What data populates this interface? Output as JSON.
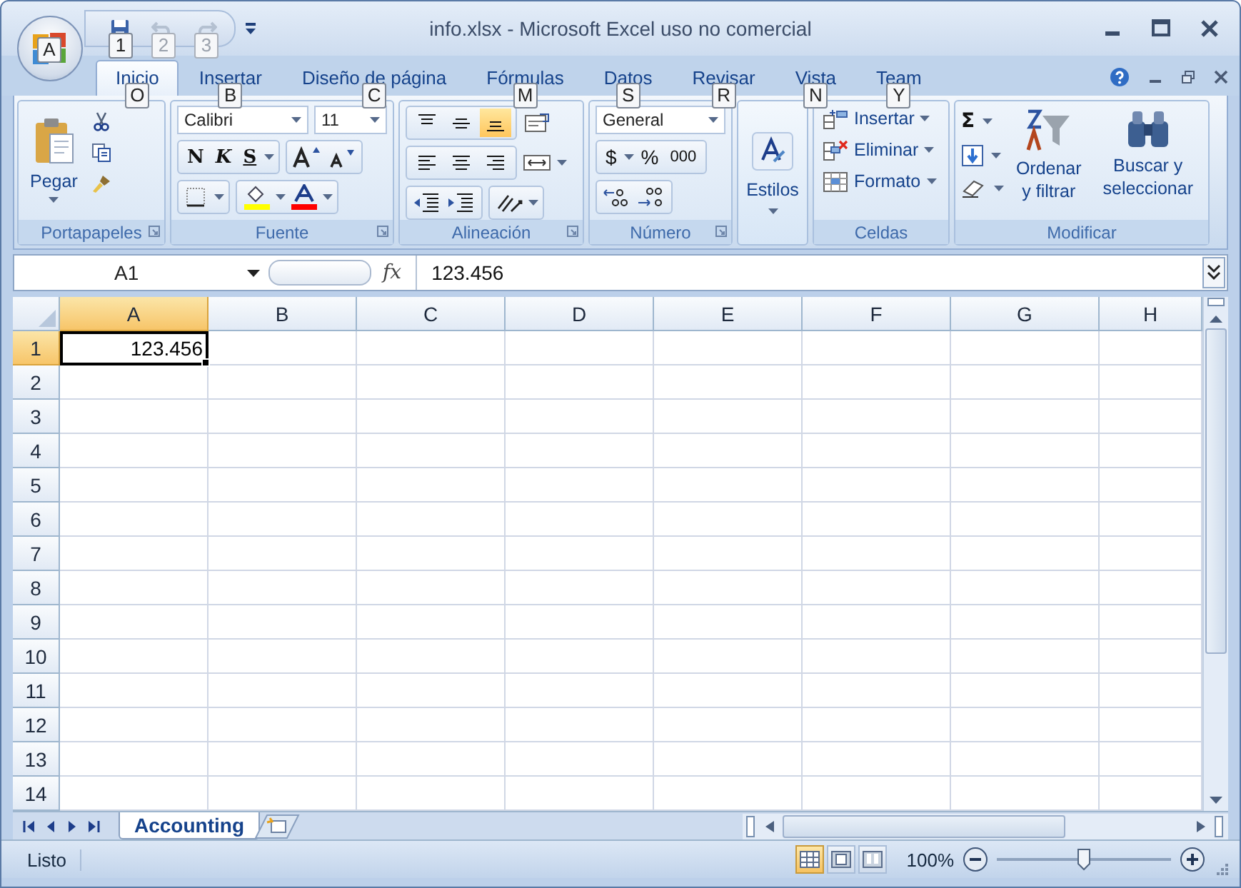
{
  "window": {
    "title": "info.xlsx - Microsoft Excel uso no comercial",
    "office_keytip": "A"
  },
  "quick_access": [
    {
      "kind": "save",
      "keytip": "1",
      "disabled": false
    },
    {
      "kind": "undo",
      "keytip": "2",
      "disabled": true
    },
    {
      "kind": "redo",
      "keytip": "3",
      "disabled": true
    }
  ],
  "tabs": [
    {
      "label": "Inicio",
      "keytip": "O",
      "selected": true
    },
    {
      "label": "Insertar",
      "keytip": "B",
      "selected": false
    },
    {
      "label": "Diseño de página",
      "keytip": "C",
      "selected": false
    },
    {
      "label": "Fórmulas",
      "keytip": "M",
      "selected": false
    },
    {
      "label": "Datos",
      "keytip": "S",
      "selected": false
    },
    {
      "label": "Revisar",
      "keytip": "R",
      "selected": false
    },
    {
      "label": "Vista",
      "keytip": "N",
      "selected": false
    },
    {
      "label": "Team",
      "keytip": "Y",
      "selected": false
    }
  ],
  "ribbon": {
    "clipboard": {
      "label": "Portapapeles",
      "paste": "Pegar"
    },
    "font": {
      "label": "Fuente",
      "family": "Calibri",
      "size": "11",
      "bold": "N",
      "italic": "K",
      "underline": "S"
    },
    "alignment": {
      "label": "Alineación",
      "vertical": [
        {
          "kind": "top",
          "selected": false
        },
        {
          "kind": "middle",
          "selected": false
        },
        {
          "kind": "bottom",
          "selected": true
        }
      ],
      "horizontal": [
        {
          "kind": "left",
          "selected": false
        },
        {
          "kind": "center",
          "selected": false
        },
        {
          "kind": "right",
          "selected": false
        }
      ]
    },
    "number": {
      "label": "Número",
      "format": "General",
      "currency": "$",
      "percent": "%",
      "thousands": "000"
    },
    "styles": {
      "label": "Estilos"
    },
    "cells": {
      "label": "Celdas",
      "items": [
        {
          "kind": "insert",
          "label": "Insertar"
        },
        {
          "kind": "delete",
          "label": "Eliminar"
        },
        {
          "kind": "format",
          "label": "Formato"
        }
      ]
    },
    "editing": {
      "label": "Modificar",
      "sum": "Σ",
      "sort": "Ordenar y filtrar",
      "find": "Buscar y seleccionar"
    }
  },
  "formula_bar": {
    "name_box": "A1",
    "fx": "fx",
    "value": "123.456"
  },
  "sheet": {
    "columns": [
      "A",
      "B",
      "C",
      "D",
      "E",
      "F",
      "G",
      "H"
    ],
    "rows": [
      {
        "label": "1",
        "cells": [
          {
            "value": "123.456",
            "selected": true
          }
        ]
      },
      {
        "label": "2"
      },
      {
        "label": "3"
      },
      {
        "label": "4"
      },
      {
        "label": "5"
      },
      {
        "label": "6"
      },
      {
        "label": "7"
      },
      {
        "label": "8"
      },
      {
        "label": "9"
      },
      {
        "label": "10"
      },
      {
        "label": "11"
      },
      {
        "label": "12"
      },
      {
        "label": "13"
      },
      {
        "label": "14"
      }
    ]
  },
  "sheet_tabs": [
    {
      "label": "Accounting",
      "selected": true
    }
  ],
  "status_bar": {
    "status": "Listo",
    "views": [
      {
        "kind": "normal",
        "selected": true
      },
      {
        "kind": "page_layout",
        "selected": false
      },
      {
        "kind": "page_break",
        "selected": false
      }
    ],
    "zoom": "100%",
    "zoom_slider": {
      "level": 0.5
    }
  }
}
